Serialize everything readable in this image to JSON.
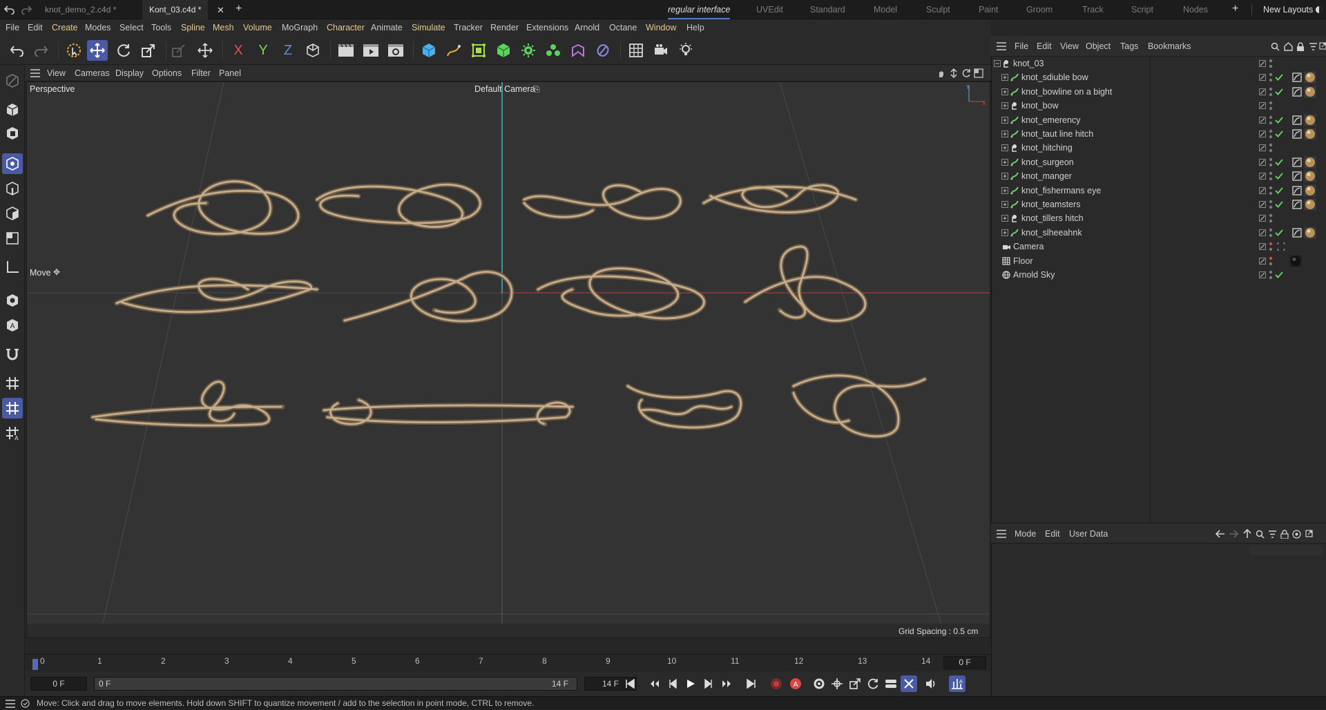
{
  "titlebar": {
    "tabs": [
      {
        "label": "knot_demo_2.c4d *",
        "active": false
      },
      {
        "label": "Kont_03.c4d *",
        "active": true
      }
    ],
    "layouts": [
      "regular interface",
      "UVEdit",
      "Standard",
      "Model",
      "Sculpt",
      "Paint",
      "Groom",
      "Track",
      "Script",
      "Nodes"
    ],
    "current_layout": "regular interface",
    "new_layouts": "New Layouts"
  },
  "menubar": {
    "items": [
      "File",
      "Edit",
      "Create",
      "Modes",
      "Select",
      "Tools",
      "Spline",
      "Mesh",
      "Volume",
      "MoGraph",
      "Character",
      "Animate",
      "Simulate",
      "Tracker",
      "Render",
      "Extensions",
      "Arnold",
      "Octane",
      "Window",
      "Help"
    ],
    "highlight_color": "#e8c98a"
  },
  "toolbar": {
    "icons": [
      "undo-icon",
      "redo-icon",
      "live-selection-icon",
      "move-icon",
      "rotate-icon",
      "scale-icon",
      "transform-icon",
      "axis-x-icon",
      "axis-y-icon",
      "axis-z-icon",
      "coordinate-system-icon",
      "render-region-icon",
      "render-view-icon",
      "render-settings-icon",
      "cube-icon",
      "pen-icon",
      "subdivision-icon",
      "extrude-icon",
      "cloner-icon",
      "field-icon",
      "deformer-icon",
      "spline-wrap-icon",
      "grid-icon",
      "camera-icon",
      "light-icon"
    ],
    "axis_x": "X",
    "axis_y": "Y",
    "axis_z": "Z",
    "accent": "#4a5aa4"
  },
  "viewport_menu": [
    "View",
    "Cameras",
    "Display",
    "Options",
    "Filter",
    "Panel"
  ],
  "viewport": {
    "projection": "Perspective",
    "camera": "Default Camera",
    "tool_label": "Move",
    "grid_spacing": "Grid Spacing : 0.5 cm"
  },
  "timeline": {
    "ticks": [
      "0",
      "1",
      "2",
      "3",
      "4",
      "5",
      "6",
      "7",
      "8",
      "9",
      "10",
      "11",
      "12",
      "13",
      "14"
    ],
    "current_frame": "0 F"
  },
  "transport": {
    "start_frame": "0 F",
    "range_start": "0 F",
    "range_end": "14 F",
    "end_frame": "14 F"
  },
  "object_manager": {
    "menu": [
      "File",
      "Edit",
      "View",
      "Object",
      "Tags",
      "Bookmarks"
    ],
    "objects": [
      {
        "name": "knot_03",
        "type": "null",
        "level": 0,
        "check": false,
        "tags": false
      },
      {
        "name": "knot_sdiuble bow",
        "type": "spline",
        "level": 1,
        "check": true,
        "tags": true
      },
      {
        "name": "knot_bowline on a bight",
        "type": "spline",
        "level": 1,
        "check": true,
        "tags": true
      },
      {
        "name": "knot_bow",
        "type": "null",
        "level": 1,
        "check": false,
        "tags": false
      },
      {
        "name": "knot_emerency",
        "type": "spline",
        "level": 1,
        "check": true,
        "tags": true
      },
      {
        "name": "knot_taut line hitch",
        "type": "spline",
        "level": 1,
        "check": true,
        "tags": true
      },
      {
        "name": "knot_hitching",
        "type": "null",
        "level": 1,
        "check": false,
        "tags": false
      },
      {
        "name": "knot_surgeon",
        "type": "spline",
        "level": 1,
        "check": true,
        "tags": true
      },
      {
        "name": "knot_manger",
        "type": "spline",
        "level": 1,
        "check": true,
        "tags": true
      },
      {
        "name": "knot_fishermans eye",
        "type": "spline",
        "level": 1,
        "check": true,
        "tags": true
      },
      {
        "name": "knot_teamsters",
        "type": "spline",
        "level": 1,
        "check": true,
        "tags": true
      },
      {
        "name": "knot_tillers hitch",
        "type": "null",
        "level": 1,
        "check": false,
        "tags": false
      },
      {
        "name": "knot_slheeahnk",
        "type": "spline",
        "level": 1,
        "check": true,
        "tags": true
      },
      {
        "name": "Camera",
        "type": "camera",
        "level": 0,
        "check": false,
        "tags": false
      },
      {
        "name": "Floor",
        "type": "floor",
        "level": 0,
        "check": false,
        "tags": false
      },
      {
        "name": "Arnold Sky",
        "type": "sky",
        "level": 0,
        "check": true,
        "tags": false
      }
    ]
  },
  "attribute_manager": {
    "menu": [
      "Mode",
      "Edit",
      "User Data"
    ]
  },
  "status": {
    "message": "Move: Click and drag to move elements. Hold down SHIFT to quantize movement / add to the selection in point mode, CTRL to remove."
  }
}
